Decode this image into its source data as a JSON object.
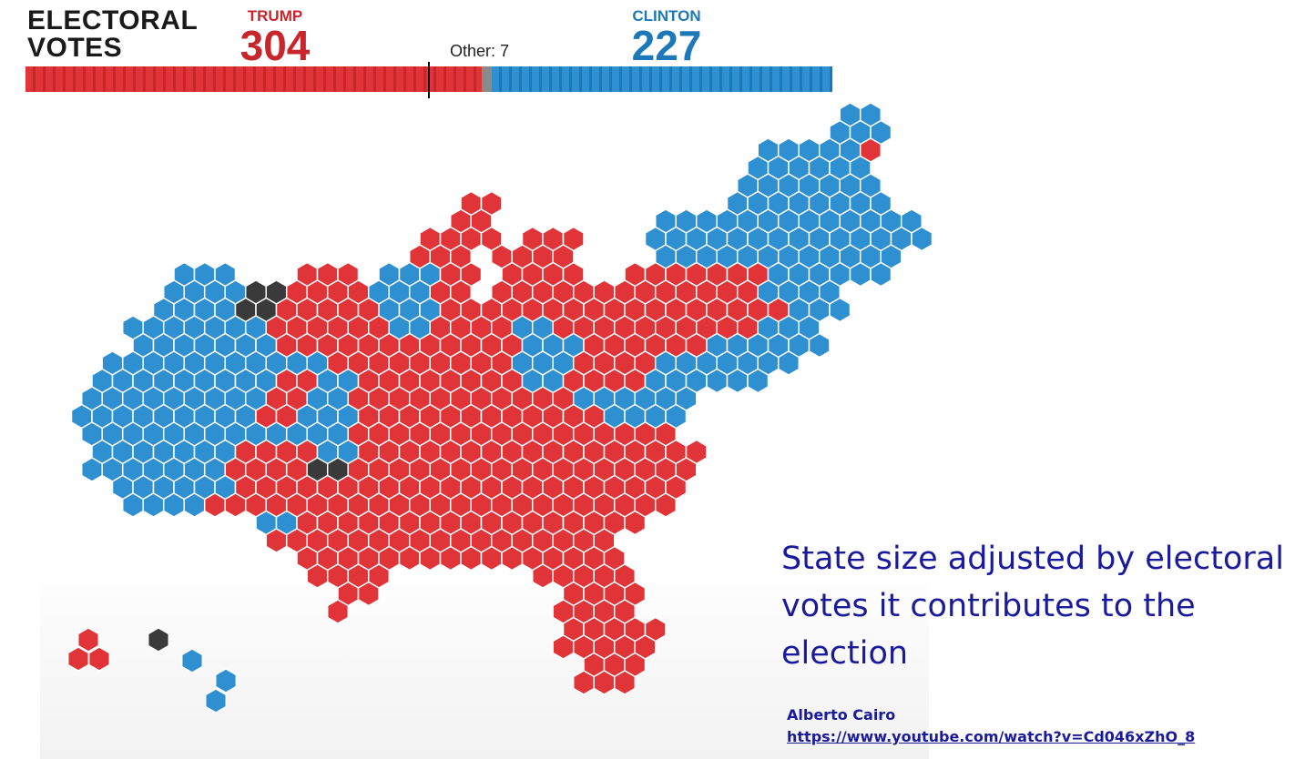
{
  "header": {
    "title_line1": "ELECTORAL",
    "title_line2": "VOTES",
    "trump": {
      "label": "TRUMP",
      "votes": "304"
    },
    "clinton": {
      "label": "CLINTON",
      "votes": "227"
    },
    "other_label": "Other: 7"
  },
  "bar": {
    "trump": 304,
    "other": 7,
    "clinton": 227,
    "total": 538,
    "majority": 270
  },
  "colors": {
    "trump": "#e13438",
    "clinton": "#2e8fd1",
    "other": "#3a3a3a",
    "trump_text": "#c8262d",
    "clinton_text": "#1d78b8",
    "caption": "#1a1a9c"
  },
  "caption": "State size adjusted by electoral votes it contributes to the election",
  "credit": {
    "author": "Alberto Cairo",
    "link": "https://www.youtube.com/watch?v=Cd046xZhO_8"
  }
}
